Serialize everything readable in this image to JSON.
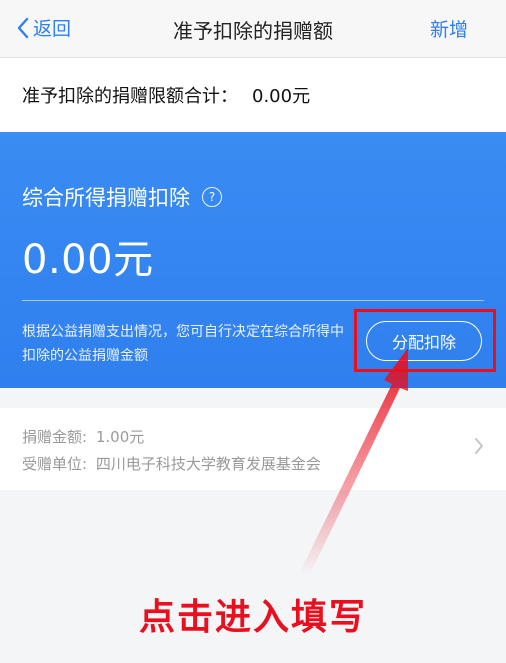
{
  "nav": {
    "back_label": "返回",
    "title": "准予扣除的捐赠额",
    "add_label": "新增"
  },
  "limit": {
    "label": "准予扣除的捐赠限额合计：",
    "value": "0.00元"
  },
  "card": {
    "title": "综合所得捐赠扣除",
    "help_glyph": "?",
    "amount": "0.00元",
    "description": "根据公益捐赠支出情况，您可自行决定在综合所得中扣除的公益捐赠金额",
    "allocate_button": "分配扣除"
  },
  "record": {
    "amount_label": "捐赠金额:",
    "amount_value": "1.00元",
    "recipient_label": "受赠单位:",
    "recipient_value": "四川电子科技大学教育发展基金会"
  },
  "annotation": {
    "callout_text": "点击进入填写",
    "highlight_color": "#e8101f"
  },
  "colors": {
    "accent": "#2f7fee",
    "link": "#2f7ff0"
  }
}
